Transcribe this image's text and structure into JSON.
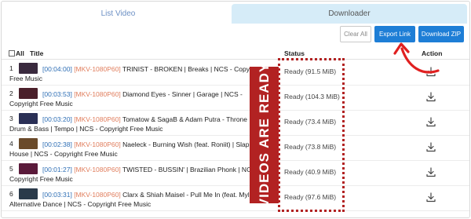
{
  "tabs": {
    "list_video": "List Video",
    "downloader": "Downloader"
  },
  "toolbar": {
    "clear_all": "Clear All",
    "export_link": "Export Link",
    "download_zip": "Download ZIP"
  },
  "table": {
    "headers": {
      "all": "All",
      "title": "Title",
      "status": "Status",
      "action": "Action"
    },
    "rows": [
      {
        "num": "1",
        "duration": "[00:04:00]",
        "format": "[MKV-1080P60]",
        "text": " TRINIST - BROKEN | Breaks | NCS - Copyright Free Music",
        "status": "Ready (91.5 MiB)",
        "thumb_color": "#3a2a3e"
      },
      {
        "num": "2",
        "duration": "[00:03:53]",
        "format": "[MKV-1080P60]",
        "text": " Diamond Eyes - Sinner | Garage | NCS - Copyright Free Music",
        "status": "Ready (104.3 MiB)",
        "thumb_color": "#4a1f2a"
      },
      {
        "num": "3",
        "duration": "[00:03:20]",
        "format": "[MKV-1080P60]",
        "text": " Tomatow & SagaB & Adam Putra - Throne | Drum & Bass | Tempo | NCS - Copyright Free Music",
        "status": "Ready (73.4 MiB)",
        "thumb_color": "#2a2f55"
      },
      {
        "num": "4",
        "duration": "[00:02:38]",
        "format": "[MKV-1080P60]",
        "text": " Naeleck - Burning Wish (feat. Roniit) | Slap House | NCS - Copyright Free Music",
        "status": "Ready (73.8 MiB)",
        "thumb_color": "#6a4a2a"
      },
      {
        "num": "5",
        "duration": "[00:01:27]",
        "format": "[MKV-1080P60]",
        "text": " TWISTED - BUSSIN' | Brazilian Phonk | NCS - Copyright Free Music",
        "status": "Ready (40.9 MiB)",
        "thumb_color": "#5a1a3a"
      },
      {
        "num": "6",
        "duration": "[00:03:31]",
        "format": "[MKV-1080P60]",
        "text": " Clarx & Shiah Maisel - Pull Me In (feat. Mylo) | Alternative Dance | NCS - Copyright Free Music",
        "status": "Ready (97.6 MiB)",
        "thumb_color": "#2a3a4a"
      }
    ]
  },
  "overlay": {
    "banner": "VIDEOS ARE READY"
  },
  "colors": {
    "accent": "#1e7ed6",
    "overlay": "#b22222",
    "duration": "#2f6fb5",
    "format": "#e07d5c",
    "tab_active": "#d6ecf8"
  },
  "icons": {
    "row_action": "download-icon",
    "annotation": "curved-arrow-icon"
  }
}
